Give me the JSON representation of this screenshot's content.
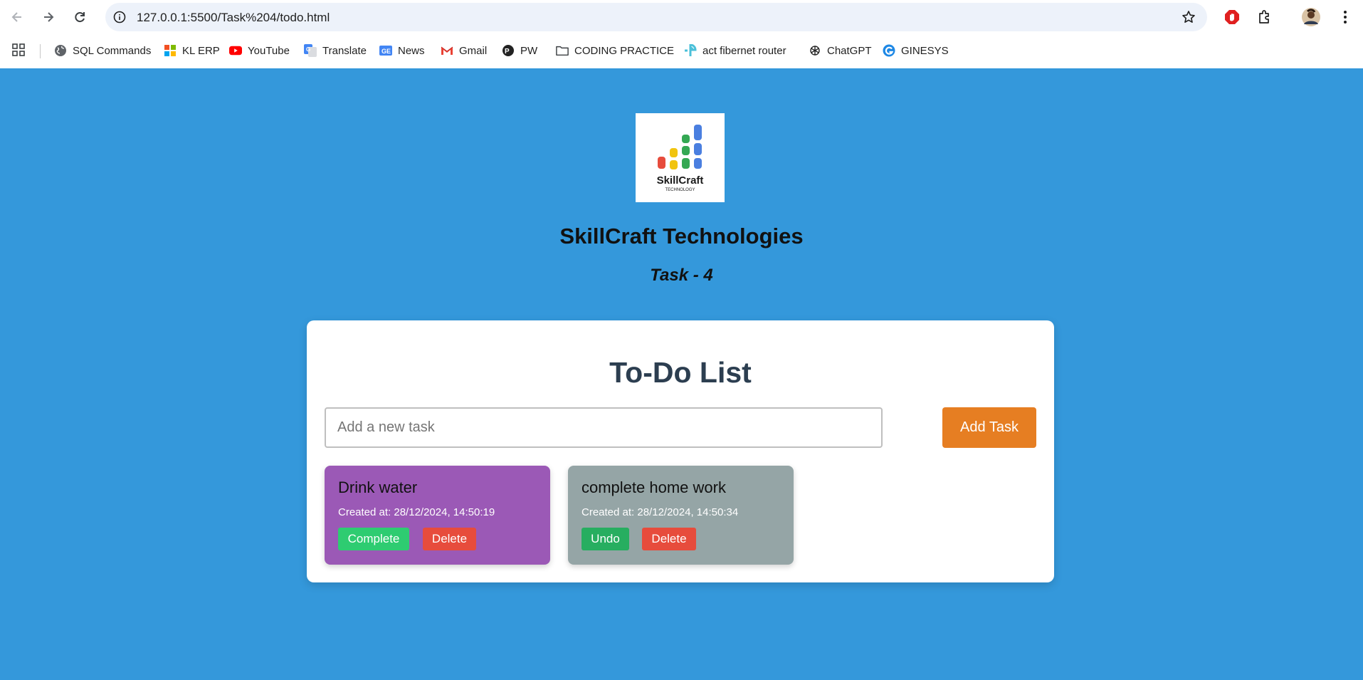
{
  "browser": {
    "url": "127.0.0.1:5500/Task%204/todo.html",
    "bookmarks": [
      {
        "label": "SQL Commands",
        "icon": "globe-icon"
      },
      {
        "label": "KL ERP",
        "icon": "kl-erp-icon"
      },
      {
        "label": "YouTube",
        "icon": "youtube-icon"
      },
      {
        "label": "Translate",
        "icon": "translate-icon"
      },
      {
        "label": "News",
        "icon": "news-icon"
      },
      {
        "label": "Gmail",
        "icon": "gmail-icon"
      },
      {
        "label": "PW",
        "icon": "pw-icon"
      },
      {
        "label": "CODING PRACTICE",
        "icon": "folder-icon"
      },
      {
        "label": "act fibernet router",
        "icon": "router-icon"
      },
      {
        "label": "ChatGPT",
        "icon": "chatgpt-icon"
      },
      {
        "label": "GINESYS",
        "icon": "ginesys-icon"
      }
    ]
  },
  "page": {
    "logo_text": "SkillCraft",
    "logo_subtext": "TECHNOLOGY",
    "site_title": "SkillCraft Technologies",
    "task_label": "Task - 4",
    "card": {
      "title": "To-Do List",
      "input_placeholder": "Add a new task",
      "add_button": "Add Task",
      "todos": [
        {
          "text": "Drink water",
          "created": "Created at: 28/12/2024, 14:50:19",
          "action": "Complete",
          "delete": "Delete",
          "color": "#9b59b6"
        },
        {
          "text": "complete home work",
          "created": "Created at: 28/12/2024, 14:50:34",
          "action": "Undo",
          "delete": "Delete",
          "color": "#95a5a6"
        }
      ]
    }
  },
  "colors": {
    "background": "#3498db",
    "accent_orange": "#e67e22",
    "complete_green": "#2ecc71",
    "undo_green": "#27ae60",
    "delete_red": "#e74c3c",
    "title_navy": "#2c3e50"
  }
}
